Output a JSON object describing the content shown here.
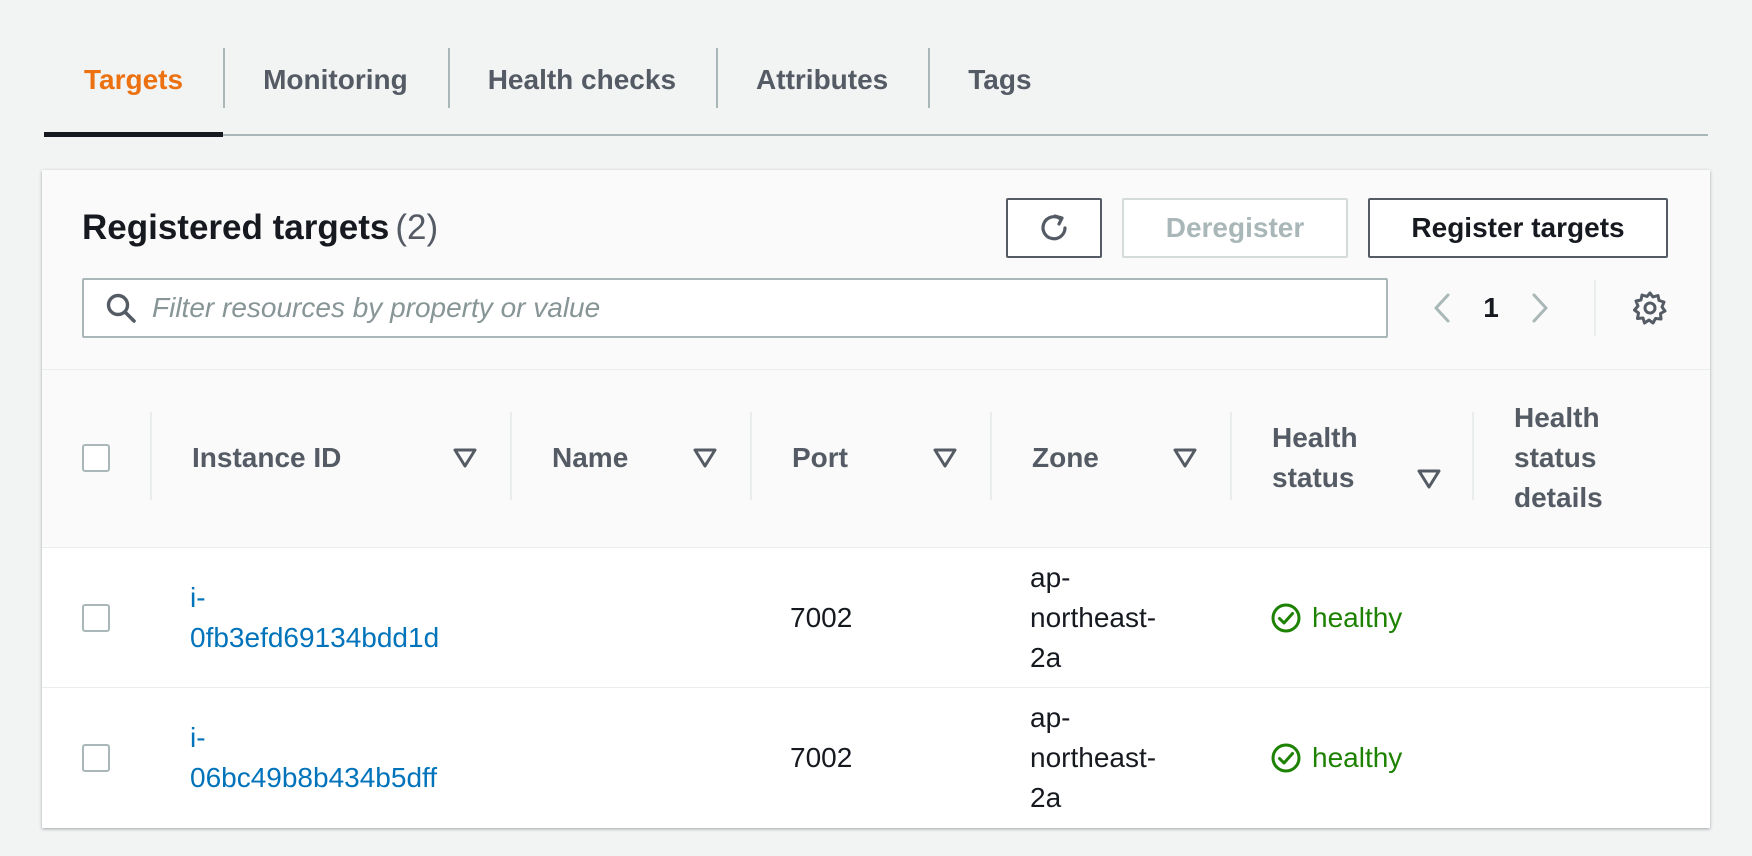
{
  "tabs": [
    {
      "label": "Targets",
      "active": true
    },
    {
      "label": "Monitoring",
      "active": false
    },
    {
      "label": "Health checks",
      "active": false
    },
    {
      "label": "Attributes",
      "active": false
    },
    {
      "label": "Tags",
      "active": false
    }
  ],
  "panel": {
    "title": "Registered targets",
    "count": "(2)",
    "buttons": {
      "refresh_icon": "refresh-icon",
      "deregister": "Deregister",
      "register": "Register targets"
    },
    "search": {
      "placeholder": "Filter resources by property or value",
      "value": ""
    },
    "pagination": {
      "current_page": "1"
    }
  },
  "table": {
    "columns": {
      "instance_id": "Instance ID",
      "name": "Name",
      "port": "Port",
      "zone": "Zone",
      "health_status_1": "Health",
      "health_status_2": "status",
      "health_details_1": "Health",
      "health_details_2": "status",
      "health_details_3": "details"
    },
    "rows": [
      {
        "instance_id_1": "i-",
        "instance_id_2": "0fb3efd69134bdd1d",
        "name": "",
        "port": "7002",
        "zone_1": "ap-",
        "zone_2": "northeast-",
        "zone_3": "2a",
        "health": "healthy",
        "health_details": ""
      },
      {
        "instance_id_1": "i-",
        "instance_id_2": "06bc49b8b434b5dff",
        "name": "",
        "port": "7002",
        "zone_1": "ap-",
        "zone_2": "northeast-",
        "zone_3": "2a",
        "health": "healthy",
        "health_details": ""
      }
    ]
  },
  "colors": {
    "active_tab": "#ec7211",
    "link": "#0073bb",
    "healthy": "#1d8102",
    "background": "#f2f3f3"
  }
}
